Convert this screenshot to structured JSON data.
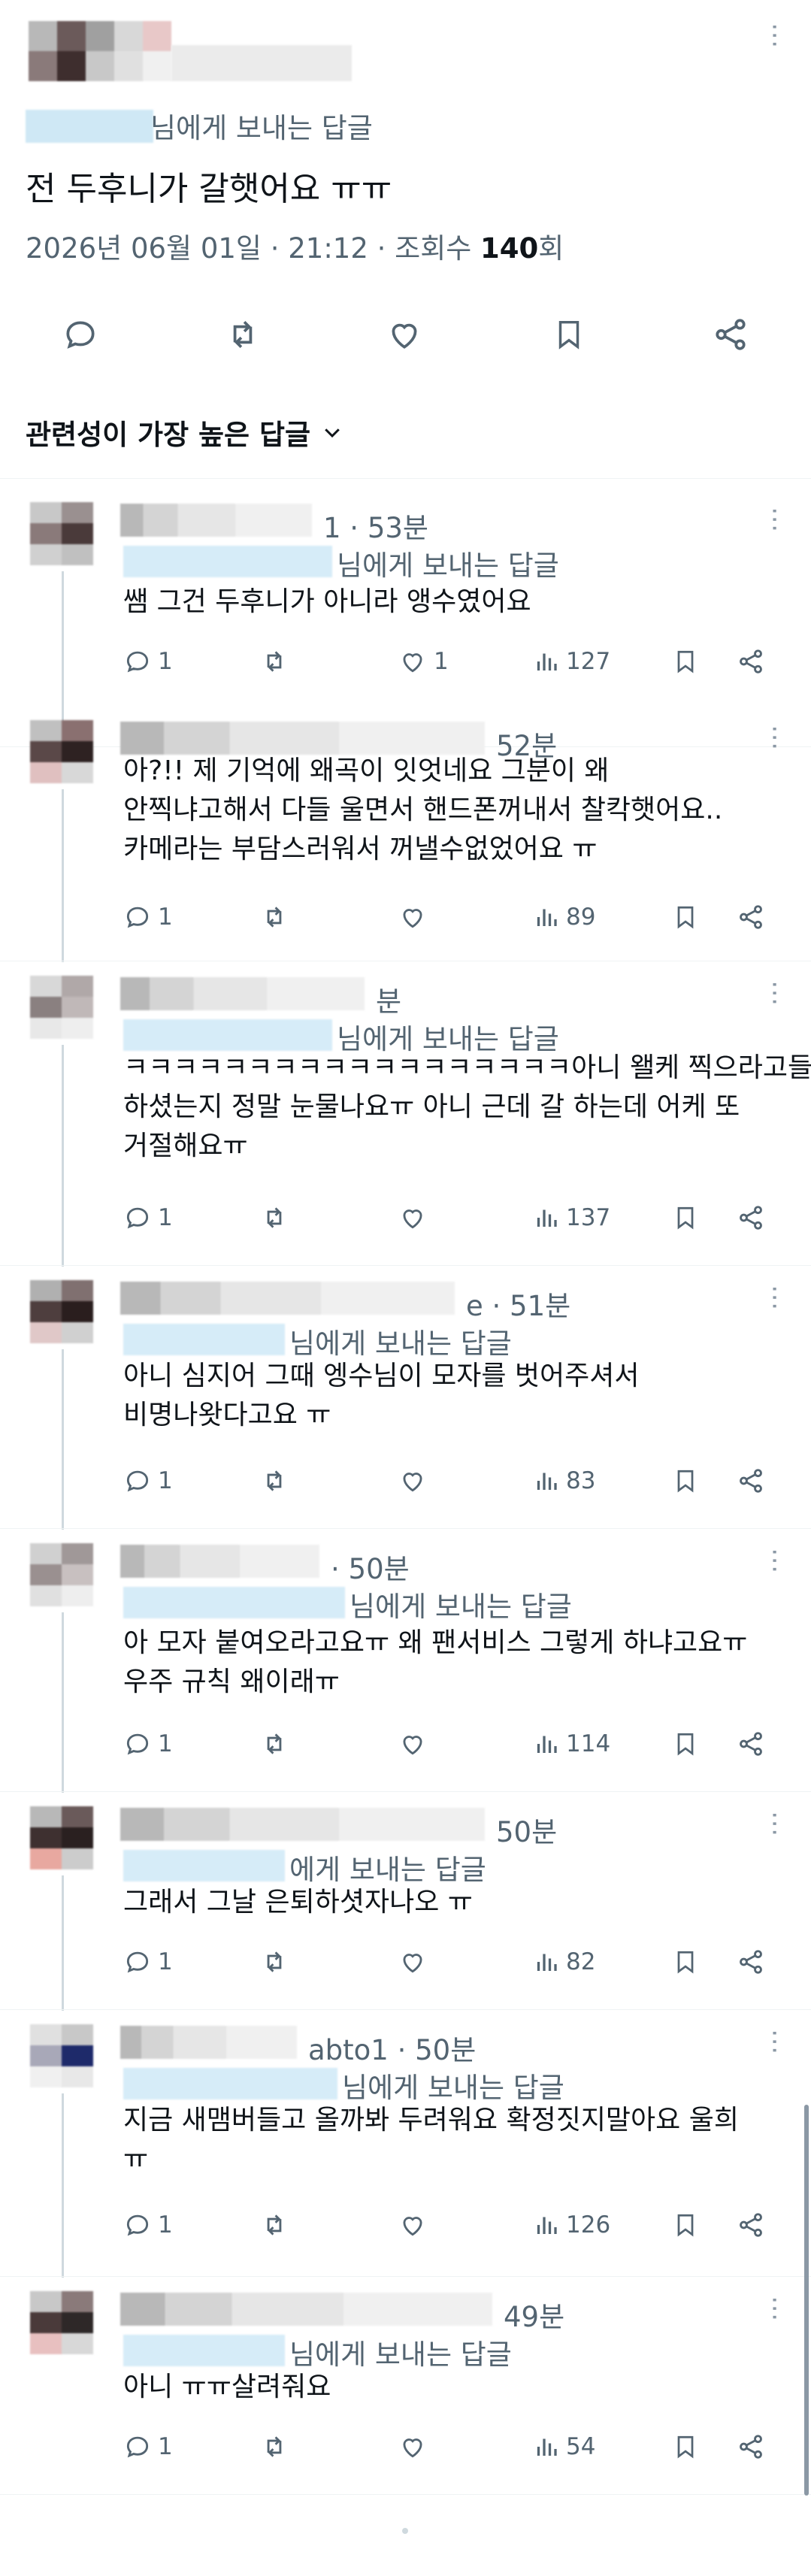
{
  "main": {
    "reply_to": "님에게 보내는 답글",
    "text": "전 두후니가 갈햇어요 ㅠㅠ",
    "date": "2026년 06월 01일 · 21:12 · 조회수 ",
    "views": "140",
    "views_unit": "회"
  },
  "sort": {
    "label": "관련성이 가장 높은 답글"
  },
  "replies": [
    {
      "handle_end": "1 · 53분",
      "reply_to": "님에게 보내는 답글",
      "body": "쌤 그건 두후니가 아니라 앵수였어요",
      "replies_count": "1",
      "likes_count": "1",
      "views_count": "127"
    },
    {
      "handle_end": "52분",
      "reply_to": "",
      "body": "아?!! 제 기억에 왜곡이 잇엇네요 그분이 왜\n안찍냐고해서 다들 울면서 핸드폰꺼내서 찰칵햇어요..\n카메라는 부담스러워서 꺼낼수없었어요 ㅠ",
      "replies_count": "1",
      "likes_count": "",
      "views_count": "89"
    },
    {
      "handle_end": "분",
      "reply_to": "님에게 보내는 답글",
      "body": "ㅋㅋㅋㅋㅋㅋㅋㅋㅋㅋㅋㅋㅋㅋㅋㅋㅋㅋ아니 왤케 찍으라고들\n하셨는지 정말 눈물나요ㅠ 아니 근데 갈 하는데 어케 또\n거절해요ㅠ",
      "replies_count": "1",
      "likes_count": "",
      "views_count": "137"
    },
    {
      "handle_end": "e · 51분",
      "reply_to": "님에게 보내는 답글",
      "body": "아니 심지어 그때 엥수님이 모자를 벗어주셔서\n비명나왓다고요 ㅠ",
      "replies_count": "1",
      "likes_count": "",
      "views_count": "83"
    },
    {
      "handle_end": "· 50분",
      "reply_to": "님에게 보내는 답글",
      "body": "아 모자 붙여오라고요ㅠ 왜 팬서비스 그렇게 하냐고요ㅠ\n우주 규칙 왜이래ㅠ",
      "replies_count": "1",
      "likes_count": "",
      "views_count": "114"
    },
    {
      "handle_end": "50분",
      "reply_to": "에게 보내는 답글",
      "body": "그래서 그날 은퇴하셧자나오 ㅠ",
      "replies_count": "1",
      "likes_count": "",
      "views_count": "82"
    },
    {
      "handle_end": "abto1 · 50분",
      "reply_to": "님에게 보내는 답글",
      "body": "지금 새맴버들고 올까봐 두려워요 확정짓지말아요 울희\nㅠ",
      "replies_count": "1",
      "likes_count": "",
      "views_count": "126"
    },
    {
      "handle_end": "49분",
      "reply_to": "님에게 보내는 답글",
      "body": "아니 ㅠㅠ살려줘요",
      "replies_count": "1",
      "likes_count": "",
      "views_count": "54"
    }
  ],
  "colors": {
    "text": "#0f1419",
    "muted": "#536471",
    "divider": "#eff3f4",
    "thread": "#cfd9de"
  },
  "icons": {
    "reply": "reply-icon",
    "retweet": "retweet-icon",
    "like": "heart-icon",
    "views": "views-icon",
    "bookmark": "bookmark-icon",
    "share": "share-icon",
    "more": "more-icon",
    "chevron": "chevron-down-icon"
  }
}
